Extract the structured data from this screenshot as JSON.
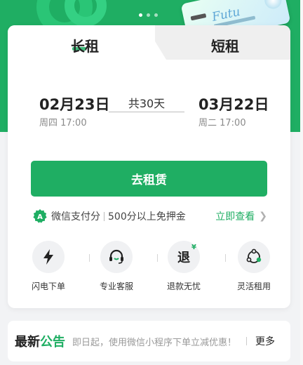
{
  "tabs": {
    "long_label": "长租",
    "short_label": "短租"
  },
  "rental": {
    "start_date": "02月23日",
    "start_day": "周四 17:00",
    "duration": "共30天",
    "end_date": "03月22日",
    "end_day": "周二 17:00"
  },
  "rent_button_label": "去租赁",
  "wechat_pay": {
    "label": "微信支付分",
    "description": "500分以上免押金",
    "link_label": "立即查看"
  },
  "features": [
    {
      "label": "闪电下单",
      "icon": "lightning-icon"
    },
    {
      "label": "专业客服",
      "icon": "headset-icon"
    },
    {
      "label": "退款无忧",
      "icon": "refund-icon"
    },
    {
      "label": "灵活租用",
      "icon": "network-icon"
    }
  ],
  "refund_icon_text": "退",
  "refund_icon_symbol": "¥",
  "notice": {
    "title_part1": "最新",
    "title_part2": "公告",
    "text": "即日起，使用微信小程序下单立减优惠！",
    "more_label": "更多"
  },
  "colors": {
    "brand": "#1fae63",
    "background": "#f2f3f5"
  }
}
